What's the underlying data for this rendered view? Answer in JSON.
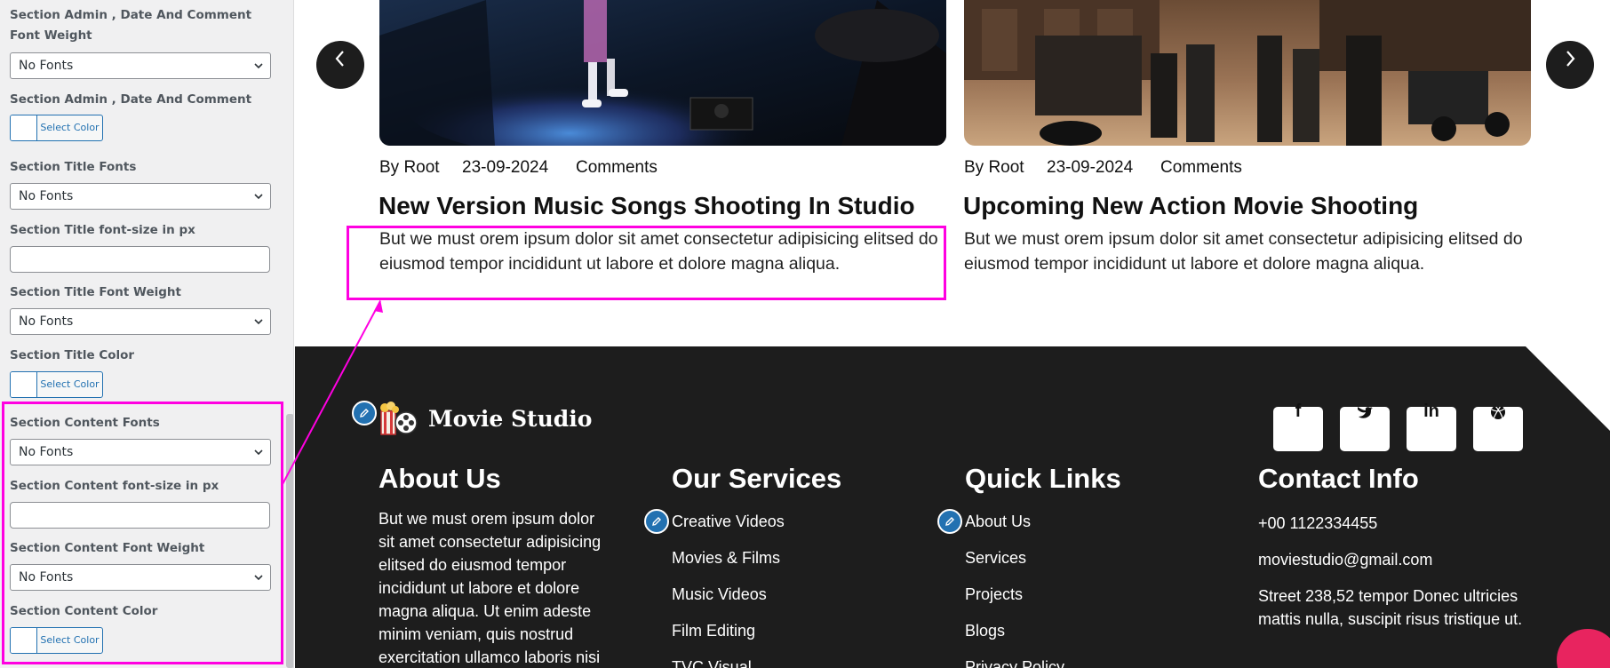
{
  "panel": {
    "admin_weight_label": "Section Admin , Date And Comment Font Weight",
    "admin_weight_value": "No Fonts",
    "admin_color_label": "Section Admin , Date And Comment Color",
    "select_color": "Select Color",
    "title_fonts_label": "Section Title Fonts",
    "title_fonts_value": "No Fonts",
    "title_size_label": "Section Title font-size in px",
    "title_size_value": "",
    "title_weight_label": "Section Title Font Weight",
    "title_weight_value": "No Fonts",
    "title_color_label": "Section Title Color",
    "content_fonts_label": "Section Content Fonts",
    "content_fonts_value": "No Fonts",
    "content_size_label": "Section Content font-size in px",
    "content_size_value": "",
    "content_weight_label": "Section Content Font Weight",
    "content_weight_value": "No Fonts",
    "content_color_label": "Section Content Color"
  },
  "posts": [
    {
      "author": "By Root",
      "date": "23-09-2024",
      "comments": "Comments",
      "title": "New Version Music Songs Shooting In Studio",
      "body": "But we must orem ipsum dolor sit amet consectetur adipisicing elitsed do eiusmod tempor incididunt ut labore et dolore magna aliqua."
    },
    {
      "author": "By Root",
      "date": "23-09-2024",
      "comments": "Comments",
      "title": "Upcoming New Action Movie Shooting",
      "body": "But we must orem ipsum dolor sit amet consectetur adipisicing elitsed do eiusmod tempor incididunt ut labore et dolore magna aliqua."
    }
  ],
  "footer": {
    "logo": "Movie Studio",
    "social": [
      "f",
      "t",
      "in",
      "dribbble"
    ],
    "about": {
      "heading": "About Us",
      "text": "But we must orem ipsum dolor sit amet consectetur adipisicing elitsed do eiusmod tempor incididunt ut labore et dolore magna aliqua. Ut enim adeste minim veniam, quis nostrud exercitation ullamco laboris nisi"
    },
    "services": {
      "heading": "Our Services",
      "items": [
        "Creative Videos",
        "Movies & Films",
        "Music Videos",
        "Film Editing",
        "TVC Visual"
      ]
    },
    "quick": {
      "heading": "Quick Links",
      "items": [
        "About Us",
        "Services",
        "Projects",
        "Blogs",
        "Privacy Policy"
      ]
    },
    "contact": {
      "heading": "Contact Info",
      "phone": "+00 1122334455",
      "email": "moviestudio@gmail.com",
      "address": "Street 238,52 tempor Donec ultricies mattis nulla, suscipit risus tristique ut."
    }
  },
  "colors": {
    "highlight": "#ff00e1",
    "footer_bg": "#1d1d1d",
    "edit_blue": "#2271b1"
  }
}
